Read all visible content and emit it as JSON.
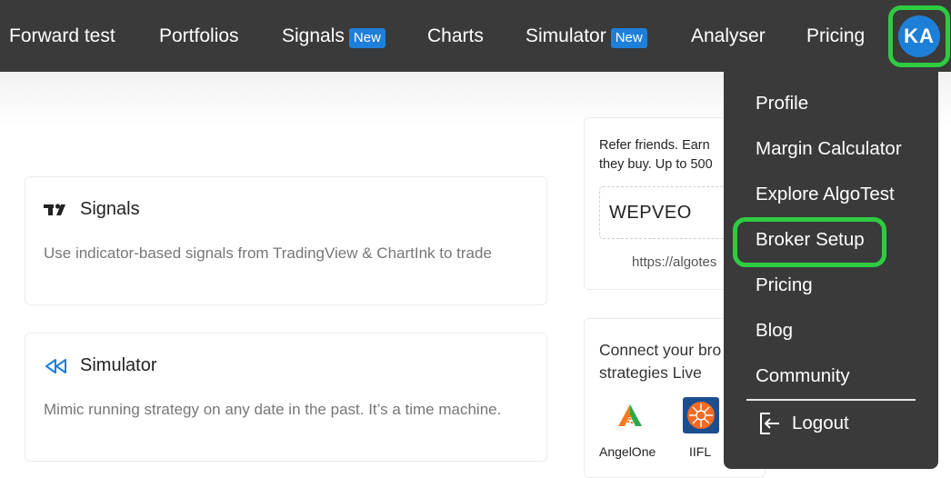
{
  "nav": {
    "items": [
      {
        "label": "Forward test"
      },
      {
        "label": "Portfolios"
      },
      {
        "label": "Signals",
        "badge": "New"
      },
      {
        "label": "Charts"
      },
      {
        "label": "Simulator",
        "badge": "New"
      },
      {
        "label": "Analyser"
      },
      {
        "label": "Pricing"
      }
    ],
    "avatar_initials": "KA"
  },
  "cards": {
    "signals": {
      "title": "Signals",
      "description": "Use indicator-based signals from TradingView & ChartInk to trade",
      "icon": "tradingview-icon"
    },
    "simulator": {
      "title": "Simulator",
      "description": "Mimic running strategy on any date in the past. It’s a time machine.",
      "icon": "rewind-icon"
    }
  },
  "referral": {
    "line1": "Refer friends. Earn",
    "line2": "they buy. Up to 500",
    "code": "WEPVEO",
    "link": "https://algotes"
  },
  "brokers": {
    "line1": "Connect your bro",
    "line2": "strategies Live",
    "items": [
      {
        "name": "AngelOne",
        "icon": "angelone-logo"
      },
      {
        "name": "IIFL",
        "icon": "iifl-logo"
      }
    ]
  },
  "menu": {
    "items": [
      {
        "label": "Profile"
      },
      {
        "label": "Margin Calculator"
      },
      {
        "label": "Explore AlgoTest"
      },
      {
        "label": "Broker Setup"
      },
      {
        "label": "Pricing"
      },
      {
        "label": "Blog"
      },
      {
        "label": "Community"
      }
    ],
    "logout_label": "Logout"
  },
  "colors": {
    "topbar": "#3a3a3a",
    "accent_blue": "#1e7fd8",
    "highlight_green": "#2ecc40"
  }
}
